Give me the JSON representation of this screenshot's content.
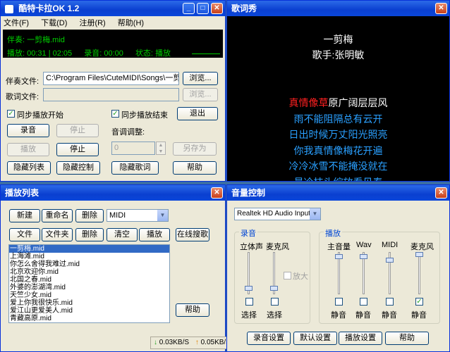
{
  "main": {
    "title": "酷特卡拉OK 1.2",
    "menu": [
      "文件(F)",
      "下载(D)",
      "注册(R)",
      "帮助(H)"
    ],
    "lcd": {
      "song": "伴奏: 一剪梅.mid",
      "play_label": "播放:",
      "time": "00:31 | 02:05",
      "rec_label": "录音:",
      "rec_time": "00:00",
      "state_label": "状态:",
      "state": "播放"
    },
    "accomp_label": "伴奏文件:",
    "accomp_value": "C:\\Program Files\\CuteMIDI\\Songs\\一剪梅",
    "lyric_label": "歌词文件:",
    "browse": "浏览...",
    "browse2": "浏览...",
    "sync_start": "同步播放开始",
    "sync_end": "同步播放结束",
    "exit": "退出",
    "record": "录音",
    "stop1": "停止",
    "pitch_label": "音调调整:",
    "play": "播放",
    "stop2": "停止",
    "pitch_value": "0",
    "save_as": "另存为",
    "hide_list": "隐藏列表",
    "hide_ctrl": "隐藏控制",
    "hide_lyrics": "隐藏歌词",
    "help": "帮助"
  },
  "lyrics": {
    "title": "歌词秀",
    "song": "一剪梅",
    "singer": "歌手:张明敏",
    "line1_sung": "真情像草",
    "line1_rest": "原广阔层层风",
    "line2": "雨不能阻隔总有云开",
    "line3": "日出时候万丈阳光照亮",
    "line4": "你我真情像梅花开遍",
    "line5": "冷冷冰雪不能掩没就在",
    "line6": "最冷枝头绽放看见春",
    "colors": {
      "sung": "#ff2020",
      "normal": "#ffffff",
      "upcoming": "#2aa0ff"
    }
  },
  "playlist": {
    "title": "播放列表",
    "new": "新建",
    "rename": "重命名",
    "delete": "删除",
    "category": "MIDI",
    "file": "文件",
    "folder": "文件夹",
    "delete2": "删除",
    "clear": "清空",
    "play": "播放",
    "online": "在线搜歌",
    "items": [
      "一剪梅.mid",
      "上海滩.mid",
      "你怎么舍得我难过.mid",
      "北京欢迎你.mid",
      "北国之春.mid",
      "外婆的澎湖湾.mid",
      "天竺少女.mid",
      "爱上你我很快乐.mid",
      "爱江山更爱美人.mid",
      "青藏高原.mid"
    ],
    "help": "帮助",
    "down_speed": "0.03KB/S",
    "up_speed": "0.05KB/S"
  },
  "volume": {
    "title": "音量控制",
    "device": "Realtek HD Audio Input",
    "rec_group": "录音",
    "play_group": "播放",
    "rec_ch": [
      {
        "name": "立体声",
        "select": "选择",
        "level": 0.1
      },
      {
        "name": "麦克风",
        "select": "选择",
        "level": 0.1
      }
    ],
    "amplify": "放大",
    "play_ch": [
      {
        "name": "主音量",
        "mute": "静音",
        "level": 0.95,
        "checked": false
      },
      {
        "name": "Wav",
        "mute": "静音",
        "level": 0.95,
        "checked": false
      },
      {
        "name": "MIDI",
        "mute": "静音",
        "level": 0.85,
        "checked": false
      },
      {
        "name": "麦克风",
        "mute": "静音",
        "level": 1.0,
        "checked": true
      }
    ],
    "rec_settings": "录音设置",
    "default": "默认设置",
    "play_settings": "播放设置",
    "help": "帮助"
  }
}
